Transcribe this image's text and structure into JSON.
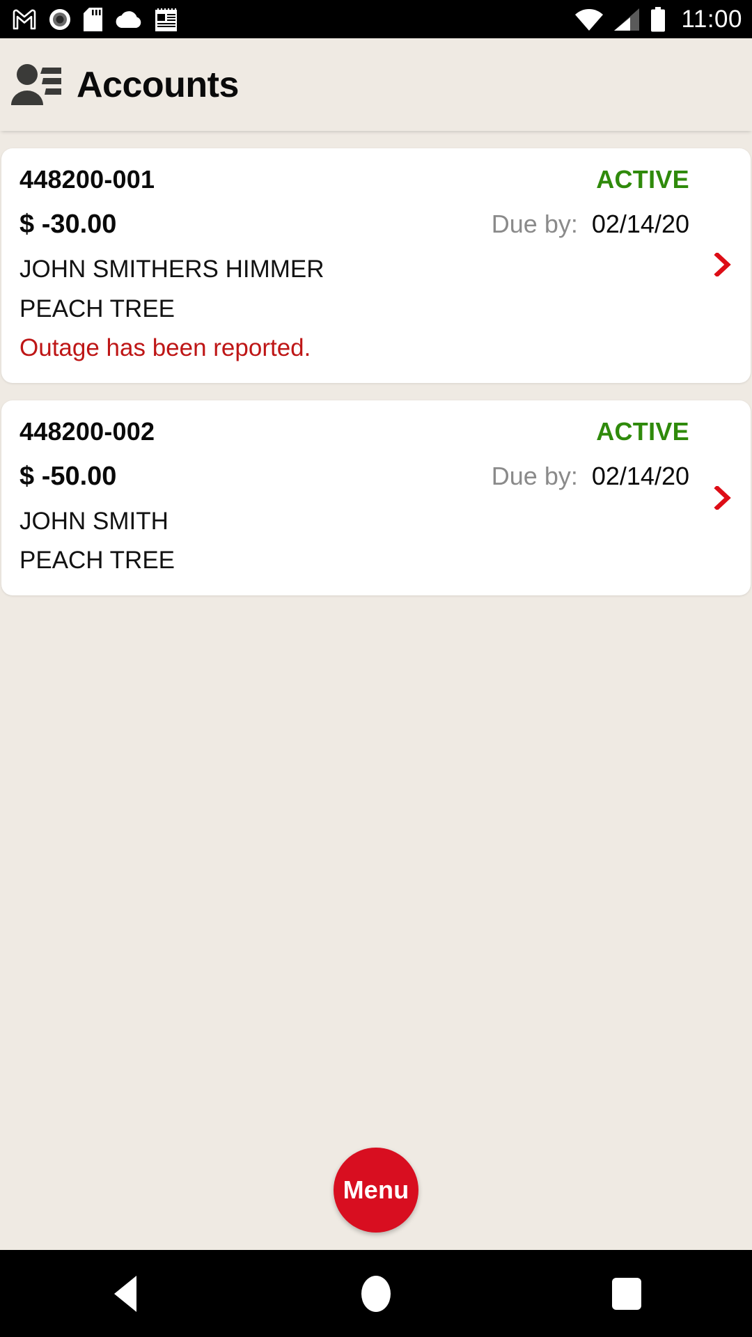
{
  "statusbar": {
    "left_icons": [
      "gmail-icon",
      "record-circle-icon",
      "sd-card-icon",
      "cloud-icon",
      "notepad-icon"
    ],
    "right_icons": [
      "wifi-icon",
      "cellular-signal-icon",
      "battery-icon"
    ],
    "time": "11:00",
    "background": "#000000",
    "foreground": "#FFFFFF"
  },
  "appbar": {
    "icon": "account-person-list-icon",
    "title": "Accounts",
    "background": "#EFEAE3",
    "icon_color": "#3A3A38"
  },
  "colors": {
    "page_background": "#EFEAE3",
    "card_background": "#FFFFFF",
    "status_active": "#2F8A0B",
    "alert_red": "#BE1616",
    "chevron_red": "#DD0D16",
    "fab_red": "#D80E20",
    "muted_label": "#8A8A8A",
    "primary_text": "#0A0A0A"
  },
  "labels": {
    "due_by": "Due by:"
  },
  "accounts": [
    {
      "account_number": "448200-001",
      "status": "ACTIVE",
      "amount": "$ -30.00",
      "due_date": "02/14/20",
      "customer_name": "JOHN SMITHERS HIMMER",
      "service_address": "PEACH TREE",
      "alert": "Outage has been reported."
    },
    {
      "account_number": "448200-002",
      "status": "ACTIVE",
      "amount": "$ -50.00",
      "due_date": "02/14/20",
      "customer_name": "JOHN SMITH",
      "service_address": "PEACH TREE",
      "alert": ""
    }
  ],
  "fab": {
    "label": "Menu"
  },
  "navbar": {
    "back": "back-triangle-icon",
    "home": "home-circle-icon",
    "recents": "recents-square-icon"
  }
}
